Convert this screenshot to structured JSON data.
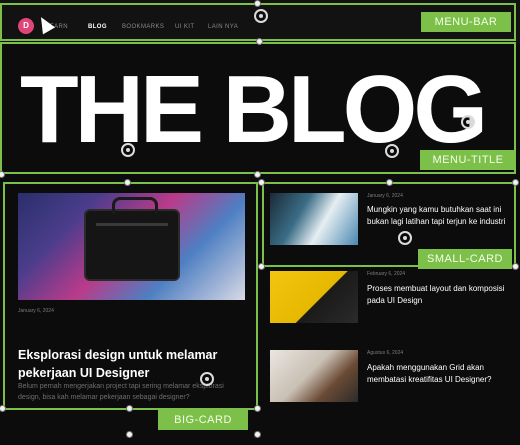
{
  "nav": {
    "logo_letter": "D",
    "items": [
      "LEARN",
      "BLOG",
      "BOOKMARKS",
      "UI KIT",
      "LAIN NYA"
    ]
  },
  "hero_title": "THE BLOG",
  "big_card": {
    "date": "January 6, 2024",
    "title": "Eksplorasi design untuk melamar pekerjaan UI Designer",
    "description": "Belum pernah mengerjakan project tapi sering melamar eksplorasi design, bisa kah melamar pekerjaan sebagai designer?"
  },
  "small_cards": [
    {
      "date": "January 6, 2024",
      "title": "Mungkin yang kamu butuhkan saat ini bukan lagi latihan tapi terjun ke industri"
    },
    {
      "date": "February 6, 2024",
      "title": "Proses membuat layout dan komposisi pada UI Design"
    },
    {
      "date": "Agustus 6, 2024",
      "title": "Apakah menggunakan Grid akan membatasi kreatifitas UI Designer?"
    }
  ],
  "annotations": {
    "menu_bar": "MENU-BAR",
    "menu_title": "MENU-TITLE",
    "small_card": "SMALL-CARD",
    "big_card": "BIG-CARD"
  },
  "colors": {
    "annotation": "#7cc04a",
    "logo": "#e0457a",
    "background": "#0c0c0c"
  }
}
